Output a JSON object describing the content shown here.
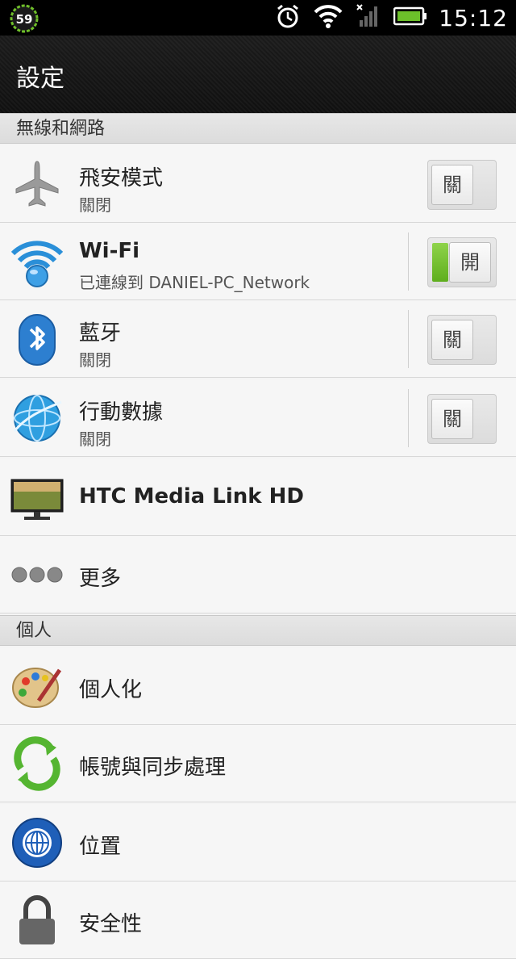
{
  "status_bar": {
    "notification_badge": "59",
    "clock": "15:12",
    "icons": [
      "alarm-icon",
      "wifi-icon",
      "signal-icon",
      "battery-icon"
    ]
  },
  "header": {
    "title": "設定"
  },
  "sections": {
    "wireless": {
      "title": "無線和網路"
    },
    "personal": {
      "title": "個人"
    }
  },
  "rows": {
    "airplane": {
      "label": "飛安模式",
      "status": "關閉",
      "toggle": "關"
    },
    "wifi": {
      "label": "Wi-Fi",
      "status": "已連線到 DANIEL-PC_Network",
      "toggle": "開"
    },
    "bluetooth": {
      "label": "藍牙",
      "status": "關閉",
      "toggle": "關"
    },
    "mobile_data": {
      "label": "行動數據",
      "status": "關閉",
      "toggle": "關"
    },
    "media_link": {
      "label": "HTC Media Link HD"
    },
    "more": {
      "label": "更多"
    },
    "personalize": {
      "label": "個人化"
    },
    "accounts_sync": {
      "label": "帳號與同步處理"
    },
    "location": {
      "label": "位置"
    },
    "security": {
      "label": "安全性"
    }
  },
  "colors": {
    "toggle_on": "#6cc02a",
    "statusbar": "#000000",
    "section_header": "#e0e0e0"
  }
}
